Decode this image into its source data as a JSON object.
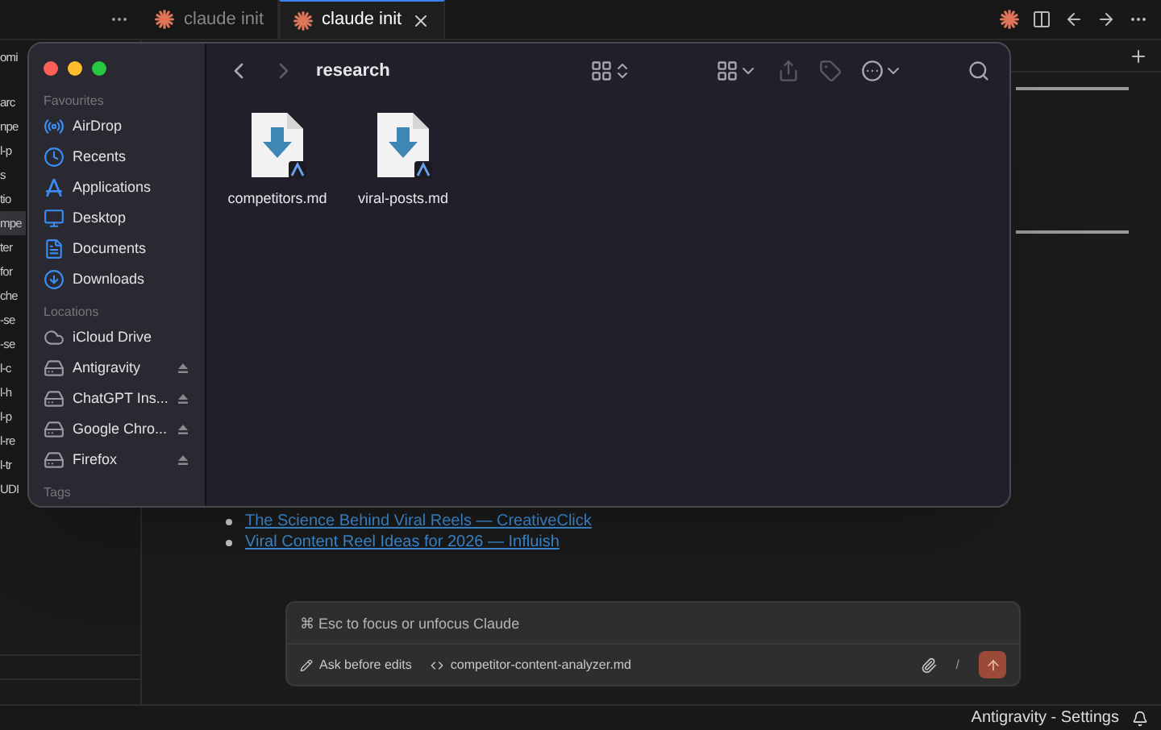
{
  "editor_tabs": [
    {
      "label": "claude init",
      "selected": false
    },
    {
      "label": "claude init",
      "selected": true
    }
  ],
  "explorer": {
    "items": [
      {
        "label": "omi",
        "selected": false
      },
      {
        "label": "arc",
        "selected": false
      },
      {
        "label": "npe",
        "selected": false
      },
      {
        "label": "l-p",
        "selected": false
      },
      {
        "label": "s",
        "selected": false
      },
      {
        "label": "tio",
        "selected": false
      },
      {
        "label": "mpe",
        "selected": true
      },
      {
        "label": "ter",
        "selected": false
      },
      {
        "label": "for",
        "selected": false
      },
      {
        "label": "che",
        "selected": false
      },
      {
        "label": "-se",
        "selected": false
      },
      {
        "label": "-se",
        "selected": false
      },
      {
        "label": "l-c",
        "selected": false
      },
      {
        "label": "l-h",
        "selected": false
      },
      {
        "label": "l-p",
        "selected": false
      },
      {
        "label": "l-re",
        "selected": false
      },
      {
        "label": "l-tr",
        "selected": false
      },
      {
        "label": "UDI",
        "selected": false
      }
    ]
  },
  "document": {
    "links": [
      "The Science Behind Viral Reels — CreativeClick",
      "Viral Content Reel Ideas for 2026 — Influish"
    ]
  },
  "chat": {
    "placeholder": "⌘ Esc to focus or unfocus Claude",
    "mode": "Ask before edits",
    "file": "competitor-content-analyzer.md",
    "slash": "/"
  },
  "status_bar": {
    "text": "Antigravity - Settings"
  },
  "finder": {
    "title": "research",
    "sections": [
      {
        "heading": "Favourites",
        "items": [
          {
            "label": "AirDrop",
            "kind": "airdrop",
            "eject": false
          },
          {
            "label": "Recents",
            "kind": "clock",
            "eject": false
          },
          {
            "label": "Applications",
            "kind": "apps",
            "eject": false
          },
          {
            "label": "Desktop",
            "kind": "desktop",
            "eject": false
          },
          {
            "label": "Documents",
            "kind": "doc",
            "eject": false
          },
          {
            "label": "Downloads",
            "kind": "download",
            "eject": false
          }
        ]
      },
      {
        "heading": "Locations",
        "items": [
          {
            "label": "iCloud Drive",
            "kind": "cloud",
            "eject": false
          },
          {
            "label": "Antigravity",
            "kind": "drive",
            "eject": true
          },
          {
            "label": "ChatGPT Ins...",
            "kind": "drive",
            "eject": true
          },
          {
            "label": "Google Chro...",
            "kind": "drive",
            "eject": true
          },
          {
            "label": "Firefox",
            "kind": "drive",
            "eject": true
          }
        ]
      },
      {
        "heading": "Tags"
      }
    ],
    "files": [
      {
        "name": "competitors.md"
      },
      {
        "name": "viral-posts.md"
      }
    ]
  }
}
